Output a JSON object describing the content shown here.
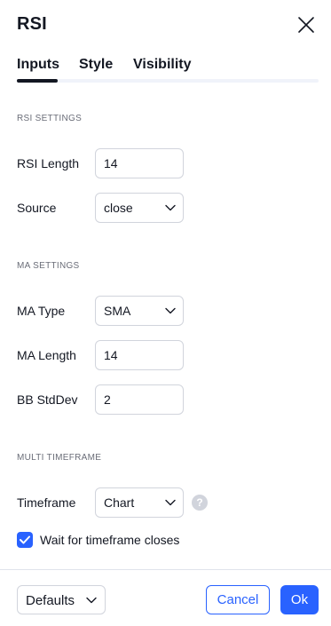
{
  "dialog": {
    "title": "RSI"
  },
  "tabs": [
    {
      "label": "Inputs",
      "active": true
    },
    {
      "label": "Style",
      "active": false
    },
    {
      "label": "Visibility",
      "active": false
    }
  ],
  "sections": {
    "rsi_settings": {
      "heading": "RSI SETTINGS",
      "rsi_length": {
        "label": "RSI Length",
        "value": "14"
      },
      "source": {
        "label": "Source",
        "value": "close"
      }
    },
    "ma_settings": {
      "heading": "MA SETTINGS",
      "ma_type": {
        "label": "MA Type",
        "value": "SMA"
      },
      "ma_length": {
        "label": "MA Length",
        "value": "14"
      },
      "bb_stddev": {
        "label": "BB StdDev",
        "value": "2"
      }
    },
    "multi_timeframe": {
      "heading": "MULTI TIMEFRAME",
      "timeframe": {
        "label": "Timeframe",
        "value": "Chart"
      },
      "help_glyph": "?",
      "wait_closes": {
        "label": "Wait for timeframe closes",
        "checked": true
      }
    }
  },
  "footer": {
    "defaults_label": "Defaults",
    "cancel_label": "Cancel",
    "ok_label": "Ok"
  },
  "colors": {
    "accent": "#2962ff",
    "text": "#131722",
    "muted": "#6a6d78",
    "border": "#d1d4dc"
  },
  "icons": {
    "close": "close-icon",
    "chevron": "chevron-down-icon",
    "help": "question-icon",
    "check": "check-icon"
  }
}
